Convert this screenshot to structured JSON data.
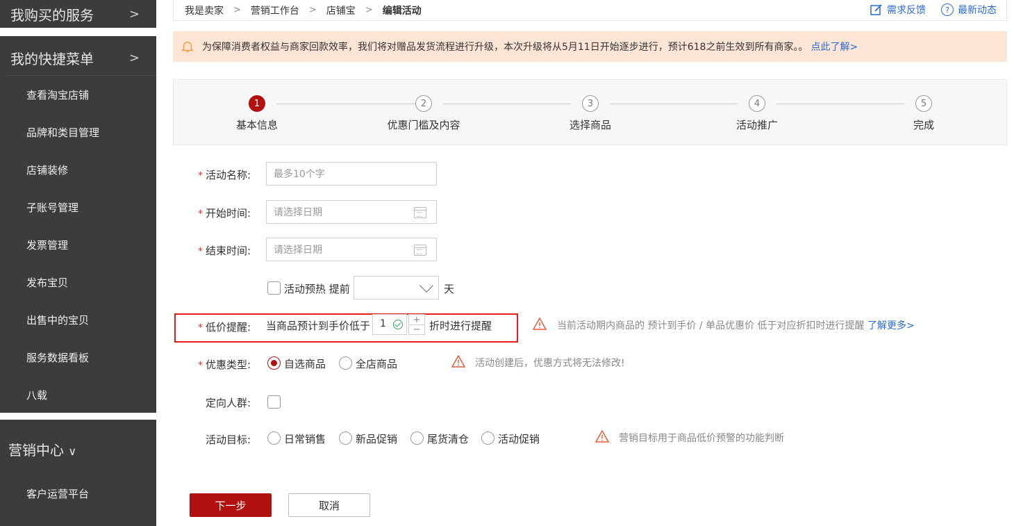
{
  "sidebar": {
    "section1": "我购买的服务",
    "section2": "我的快捷菜单",
    "items": [
      "查看淘宝店铺",
      "品牌和类目管理",
      "店铺装修",
      "子账号管理",
      "发票管理",
      "发布宝贝",
      "出售中的宝贝",
      "服务数据看板",
      "八载"
    ],
    "section3": "营销中心",
    "section3_items": [
      "客户运营平台"
    ],
    "chevron": ">"
  },
  "breadcrumb": [
    "我是卖家",
    "营销工作台",
    "店铺宝",
    "编辑活动"
  ],
  "breadcrumb_sep": ">",
  "top_actions": {
    "feedback": "需求反馈",
    "news": "最新动态",
    "help_glyph": "?"
  },
  "notice": {
    "text": "为保障消费者权益与商家回款效率，我们将对赠品发货流程进行升级，本次升级将从5月11日开始逐步进行，预计618之前生效到所有商家。。",
    "link": "点此了解>"
  },
  "steps": [
    {
      "num": "1",
      "label": "基本信息",
      "active": true
    },
    {
      "num": "2",
      "label": "优惠门槛及内容",
      "active": false
    },
    {
      "num": "3",
      "label": "选择商品",
      "active": false
    },
    {
      "num": "4",
      "label": "活动推广",
      "active": false
    },
    {
      "num": "5",
      "label": "完成",
      "active": false
    }
  ],
  "form": {
    "name_label": "活动名称:",
    "name_placeholder": "最多10个字",
    "start_label": "开始时间:",
    "start_placeholder": "请选择日期",
    "end_label": "结束时间:",
    "end_placeholder": "请选择日期",
    "preheat_label": "活动预热",
    "preheat_before": "提前",
    "preheat_unit": "天",
    "lowprice_label": "低价提醒:",
    "lowprice_text_before": "当商品预计到手价低于",
    "lowprice_value": "1",
    "lowprice_text_after": "折时进行提醒",
    "stepper_plus": "+",
    "stepper_minus": "−",
    "lowprice_hint": "当前活动期内商品的 预计到手价 / 单品优惠价 低于对应折扣时进行提醒",
    "lowprice_link": "了解更多>",
    "type_label": "优惠类型:",
    "type_options": [
      "自选商品",
      "全店商品"
    ],
    "type_selected": "自选商品",
    "type_hint": "活动创建后，优惠方式将无法修改!",
    "audience_label": "定向人群:",
    "goal_label": "活动目标:",
    "goal_options": [
      "日常销售",
      "新品促销",
      "尾货清仓",
      "活动促销"
    ],
    "goal_hint": "营销目标用于商品低价预警的功能判断",
    "required_mark": "*"
  },
  "buttons": {
    "next": "下一步",
    "cancel": "取消"
  },
  "colors": {
    "primary": "#b31010",
    "link": "#2a6bd1",
    "notice_bg": "#fde5d6",
    "sidebar_bg": "#3c3c3c",
    "highlight_border": "#e41c1c"
  }
}
